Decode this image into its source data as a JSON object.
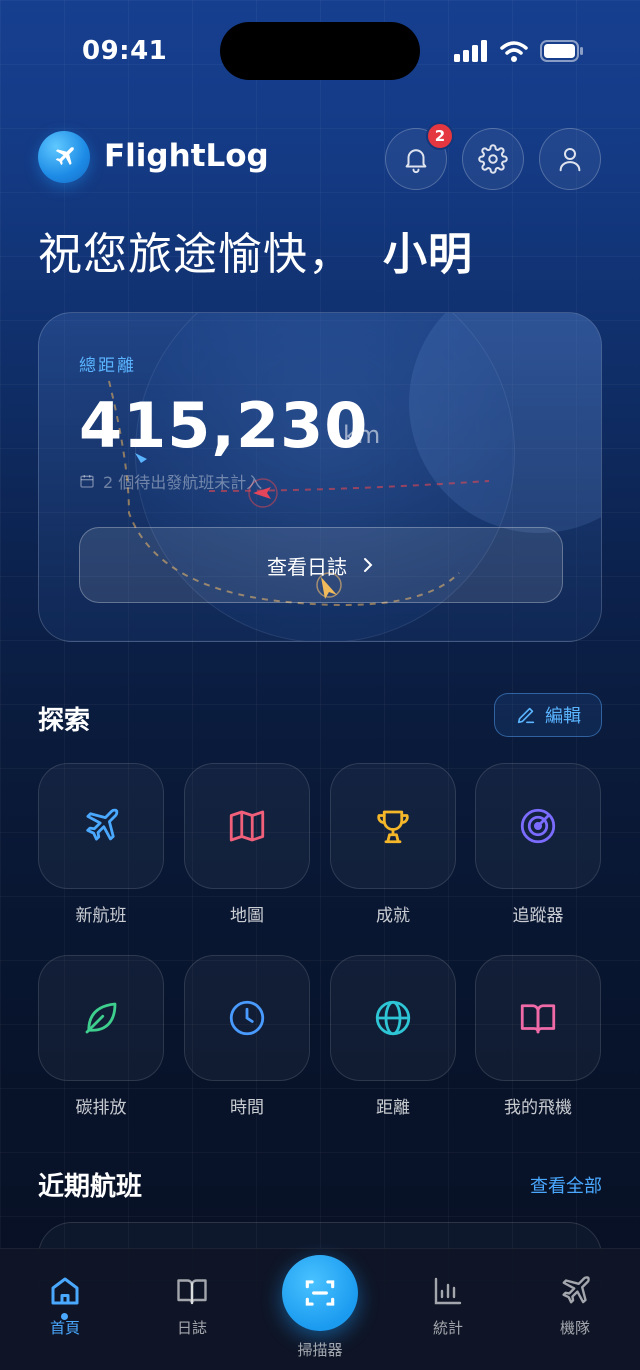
{
  "status_bar": {
    "time": "09:41"
  },
  "header": {
    "app_name": "FlightLog",
    "notification_count": "2",
    "icons": [
      "plane-icon",
      "bell-icon",
      "gear-icon",
      "user-icon"
    ]
  },
  "greeting": {
    "text": "祝您旅途愉快，",
    "name": "小明"
  },
  "distance_card": {
    "label": "總距離",
    "value": "415,230",
    "unit": "km",
    "note": "2 個待出發航班未計入",
    "button_label": "查看日誌"
  },
  "explore": {
    "title": "探索",
    "edit_label": "編輯",
    "items": [
      {
        "label": "新航班",
        "icon": "plane-icon",
        "color": "#4aa8ff"
      },
      {
        "label": "地圖",
        "icon": "map-icon",
        "color": "#f0607a"
      },
      {
        "label": "成就",
        "icon": "trophy-icon",
        "color": "#f5b72a"
      },
      {
        "label": "追蹤器",
        "icon": "radar-icon",
        "color": "#7b6cff"
      },
      {
        "label": "碳排放",
        "icon": "leaf-icon",
        "color": "#3ecf8e"
      },
      {
        "label": "時間",
        "icon": "clock-icon",
        "color": "#4a9bff"
      },
      {
        "label": "距離",
        "icon": "globe-icon",
        "color": "#2ec6d6"
      },
      {
        "label": "我的飛機",
        "icon": "book-icon",
        "color": "#f06aa8"
      }
    ]
  },
  "recent": {
    "title": "近期航班",
    "view_all": "查看全部"
  },
  "tab_bar": {
    "tabs": [
      {
        "label": "首頁",
        "icon": "home-icon",
        "active": true
      },
      {
        "label": "日誌",
        "icon": "book-icon",
        "active": false
      },
      {
        "label": "掃描器",
        "icon": "scan-icon",
        "active": false
      },
      {
        "label": "統計",
        "icon": "chart-icon",
        "active": false
      },
      {
        "label": "機隊",
        "icon": "plane-icon",
        "active": false
      }
    ]
  }
}
